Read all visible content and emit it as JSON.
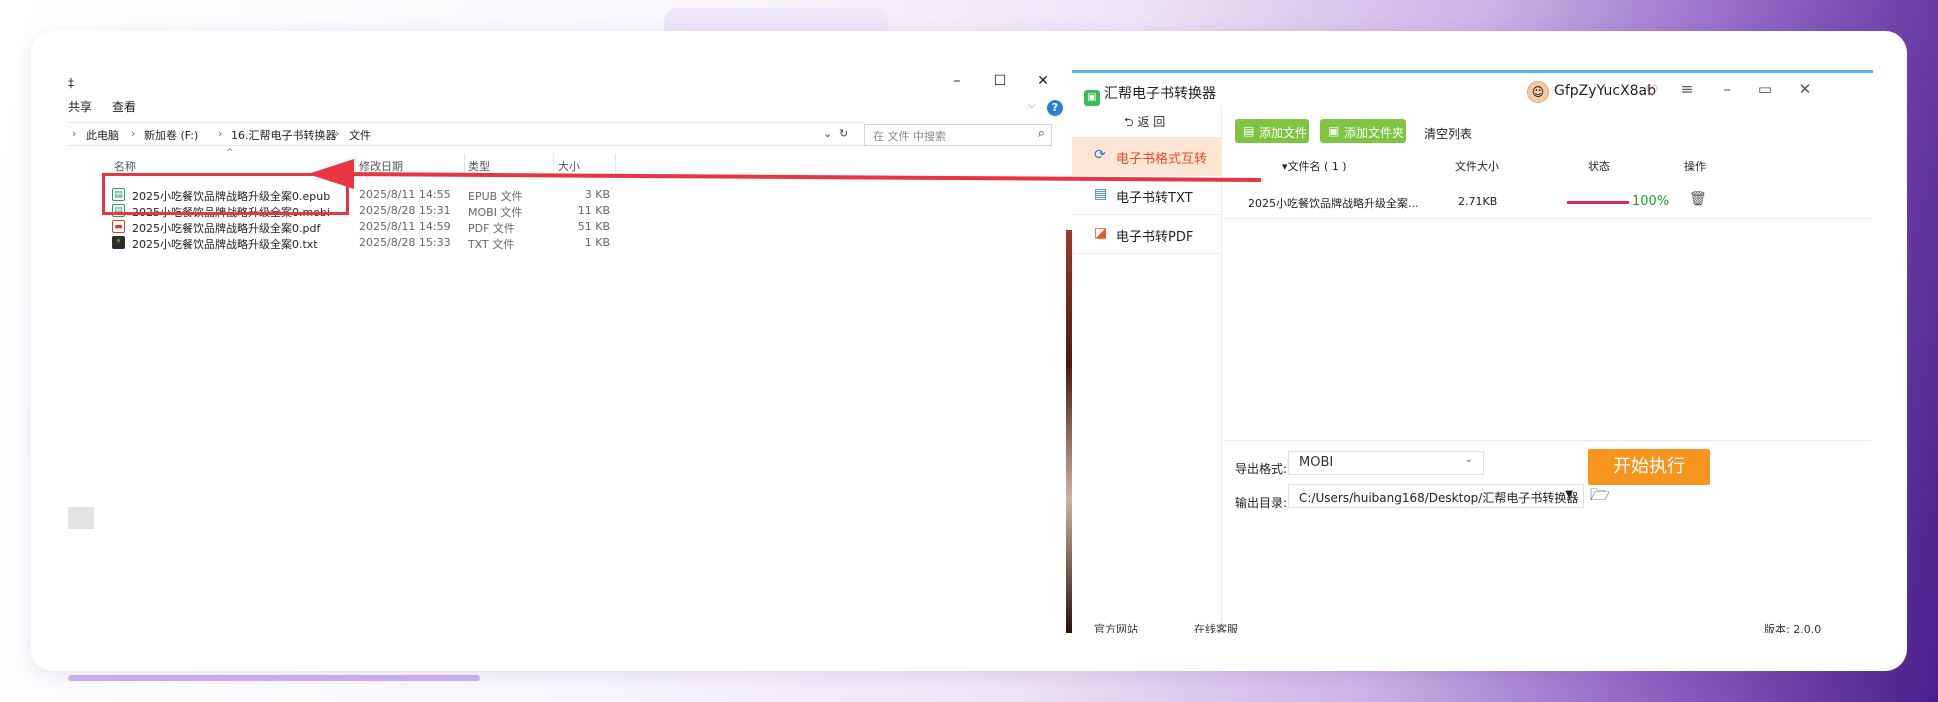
{
  "explorer": {
    "title_cut": "‡",
    "ribbon": {
      "share": "共享",
      "view": "查看"
    },
    "breadcrumb": [
      "此电脑",
      "新加卷 (F:)",
      "16.汇帮电子书转换器",
      "文件"
    ],
    "search_placeholder": "在 文件 中搜索",
    "columns": {
      "name": "名称",
      "date": "修改日期",
      "type": "类型",
      "size": "大小"
    },
    "files": [
      {
        "name": "2025小吃餐饮品牌战略升级全案0.epub",
        "date": "2025/8/11 14:55",
        "type": "EPUB 文件",
        "size": "3 KB",
        "icon": "epub-icon"
      },
      {
        "name": "2025小吃餐饮品牌战略升级全案0.mobi",
        "date": "2025/8/28 15:31",
        "type": "MOBI 文件",
        "size": "11 KB",
        "icon": "mobi-icon"
      },
      {
        "name": "2025小吃餐饮品牌战略升级全案0.pdf",
        "date": "2025/8/11 14:59",
        "type": "PDF 文件",
        "size": "51 KB",
        "icon": "pdf-icon"
      },
      {
        "name": "2025小吃餐饮品牌战略升级全案0.txt",
        "date": "2025/8/28 15:33",
        "type": "TXT 文件",
        "size": "1 KB",
        "icon": "txt-icon"
      }
    ]
  },
  "converter": {
    "title": "汇帮电子书转换器",
    "username": "GfpZyYucX8ab",
    "back": "返 回",
    "sidebar": [
      {
        "label": "电子书格式互转",
        "icon": "refresh-icon",
        "active": true
      },
      {
        "label": "电子书转TXT",
        "icon": "txt-doc-icon",
        "active": false
      },
      {
        "label": "电子书转PDF",
        "icon": "pdf-doc-icon",
        "active": false
      }
    ],
    "toolbar": {
      "add_file": "添加文件",
      "add_folder": "添加文件夹",
      "clear_list": "清空列表"
    },
    "table": {
      "headers": {
        "filename": "文件名 ( 1 )",
        "filesize": "文件大小",
        "status": "状态",
        "action": "操作"
      },
      "rows": [
        {
          "filename": "2025小吃餐饮品牌战略升级全案...",
          "filesize": "2.71KB",
          "progress": 1.0,
          "status": "100%"
        }
      ]
    },
    "export_format_label": "导出格式:",
    "export_format": "MOBI",
    "output_dir_label": "输出目录:",
    "output_dir": "C:/Users/huibang168/Desktop/汇帮电子书转换器",
    "start_button": "开始执行",
    "footer": {
      "left1": "官方网站",
      "left2": "在线客服",
      "right": "版本: 2.0.0"
    }
  },
  "colors": {
    "accent_orange": "#f7941d",
    "green_btn": "#80c542",
    "highlight_red": "#e8353f",
    "progress": "#e8245d",
    "success": "#17a535"
  }
}
